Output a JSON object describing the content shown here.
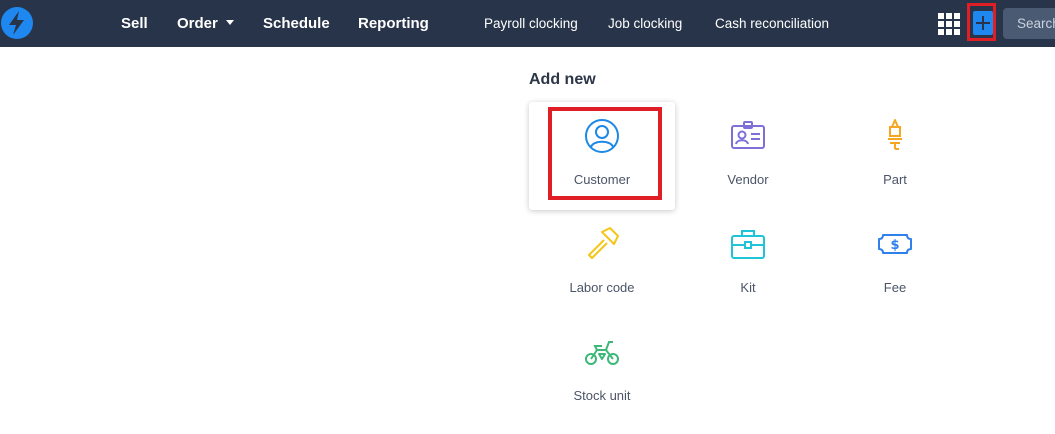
{
  "nav": {
    "primary": [
      {
        "label": "Sell"
      },
      {
        "label": "Order"
      },
      {
        "label": "Schedule"
      },
      {
        "label": "Reporting"
      }
    ],
    "secondary": [
      {
        "label": "Payroll clocking"
      },
      {
        "label": "Job clocking"
      },
      {
        "label": "Cash reconciliation"
      }
    ],
    "search_placeholder": "Search"
  },
  "add_new": {
    "title": "Add new",
    "items": [
      {
        "label": "Customer",
        "icon": "customer-icon",
        "color": "#1e88e5"
      },
      {
        "label": "Vendor",
        "icon": "vendor-card-icon",
        "color": "#7e6fd9"
      },
      {
        "label": "Part",
        "icon": "part-spark-plug-icon",
        "color": "#f5a623"
      },
      {
        "label": "Labor code",
        "icon": "hammer-icon",
        "color": "#f5c518"
      },
      {
        "label": "Kit",
        "icon": "toolbox-icon",
        "color": "#20c4d8"
      },
      {
        "label": "Fee",
        "icon": "dollar-bill-icon",
        "color": "#2f80ed"
      },
      {
        "label": "Stock unit",
        "icon": "motorcycle-icon",
        "color": "#3cb878"
      }
    ]
  },
  "colors": {
    "topbar": "#273449",
    "accent": "#1e88f0",
    "highlight": "#e01e26"
  }
}
